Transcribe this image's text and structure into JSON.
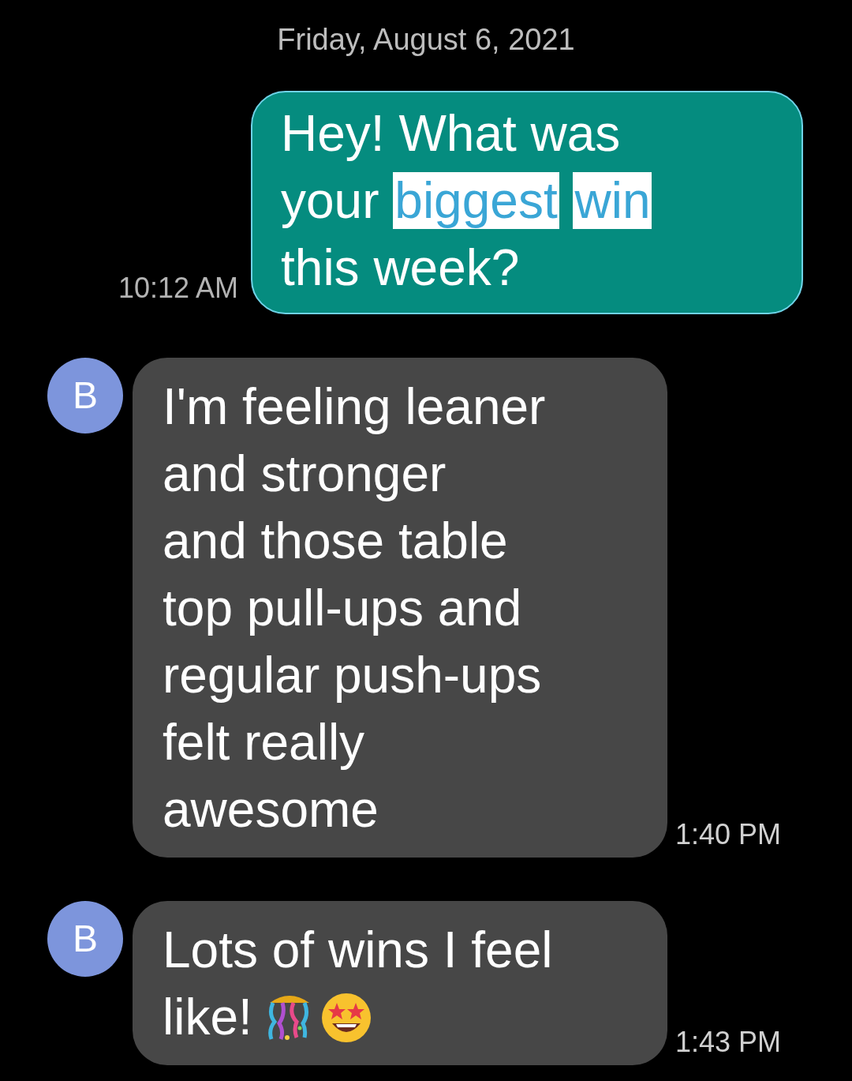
{
  "date_header": "Friday, August 6, 2021",
  "messages": [
    {
      "kind": "outgoing",
      "time": "10:12 AM",
      "lines": [
        [
          {
            "text": "Hey! What was",
            "highlighted": false
          }
        ],
        [
          {
            "text": "your",
            "highlighted": false
          },
          {
            "text": "biggest",
            "highlighted": true
          },
          {
            "text": "win",
            "highlighted": true
          }
        ],
        [
          {
            "text": "this week?",
            "highlighted": false
          }
        ]
      ]
    },
    {
      "kind": "incoming",
      "avatar": "B",
      "time": "1:40 PM",
      "lines": [
        [
          {
            "text": "I'm feeling leaner",
            "highlighted": false
          }
        ],
        [
          {
            "text": "and stronger",
            "highlighted": false
          }
        ],
        [
          {
            "text": "and those table",
            "highlighted": false
          }
        ],
        [
          {
            "text": "top pull-ups and",
            "highlighted": false
          }
        ],
        [
          {
            "text": "regular push-ups",
            "highlighted": false
          }
        ],
        [
          {
            "text": "felt really",
            "highlighted": false
          }
        ],
        [
          {
            "text": "awesome",
            "highlighted": false
          }
        ]
      ]
    },
    {
      "kind": "incoming",
      "avatar": "B",
      "time": "1:43 PM",
      "emojis": true,
      "lines": [
        [
          {
            "text": "Lots of wins I feel",
            "highlighted": false
          }
        ],
        [
          {
            "text": "like!",
            "highlighted": false
          }
        ]
      ]
    }
  ]
}
